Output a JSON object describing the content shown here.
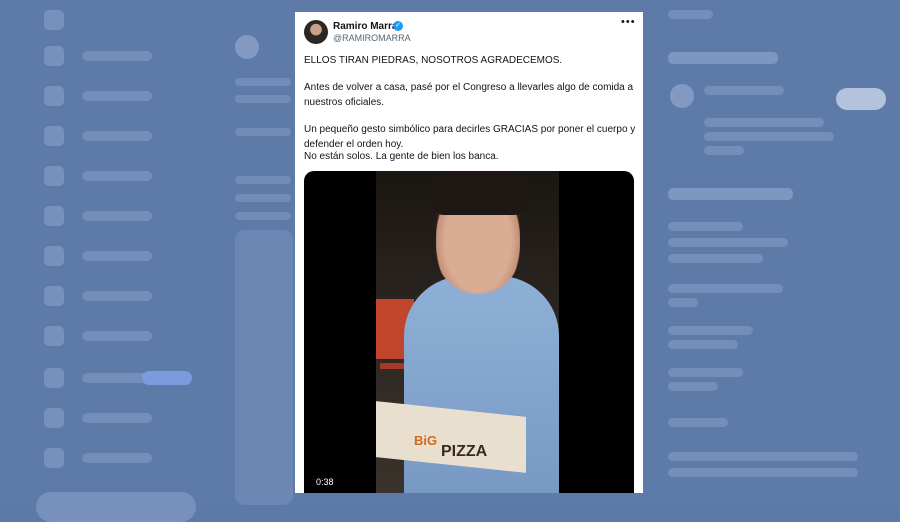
{
  "tweet": {
    "display_name": "Ramiro Marra",
    "verified_mark": "✓",
    "handle": "@RAMIROMARRA",
    "more_label": "•••",
    "line1": "ELLOS TIRAN PIEDRAS, NOSOTROS AGRADECEMOS.",
    "paragraph2": "Antes de volver a casa, pasé por el Congreso a llevarles algo de comida a nuestros oficiales.",
    "paragraph3a": "Un pequeño gesto simbólico para decirles GRACIAS por poner el cuerpo y defender el orden hoy.",
    "paragraph3b": "No están solos. La gente de bien los banca.",
    "video": {
      "timestamp": "0:38",
      "box_text_big": "BiG",
      "box_text_pizza": "PIZZA"
    }
  },
  "colors": {
    "overlay": "#5e7aa9",
    "verified": "#1d9bf0"
  },
  "icons": [
    "verified-badge-icon",
    "more-options-icon",
    "avatar"
  ]
}
